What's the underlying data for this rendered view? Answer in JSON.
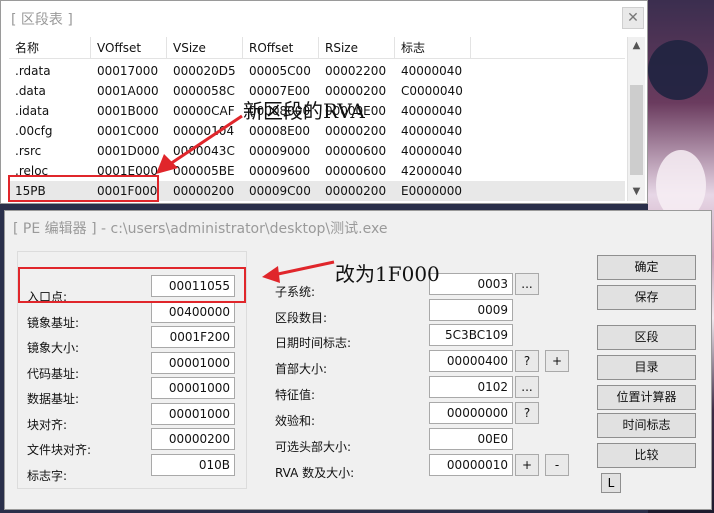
{
  "section_window": {
    "title": "[ 区段表 ]",
    "close_glyph": "✕",
    "columns": [
      "名称",
      "VOffset",
      "VSize",
      "ROffset",
      "RSize",
      "标志"
    ],
    "rows": [
      [
        ".rdata",
        "00017000",
        "000020D5",
        "00005C00",
        "00002200",
        "40000040"
      ],
      [
        ".data",
        "0001A000",
        "0000058C",
        "00007E00",
        "00000200",
        "C0000040"
      ],
      [
        ".idata",
        "0001B000",
        "00000CAF",
        "00008000",
        "00000E00",
        "40000040"
      ],
      [
        ".00cfg",
        "0001C000",
        "00000104",
        "00008E00",
        "00000200",
        "40000040"
      ],
      [
        ".rsrc",
        "0001D000",
        "0000043C",
        "00009000",
        "00000600",
        "40000040"
      ],
      [
        ".reloc",
        "0001E000",
        "000005BE",
        "00009600",
        "00000600",
        "42000040"
      ],
      [
        "15PB",
        "0001F000",
        "00000200",
        "00009C00",
        "00000200",
        "E0000000"
      ]
    ],
    "scroll_up": "▲",
    "scroll_down": "▼"
  },
  "annotations": {
    "new_section_rva": "新区段的RVA",
    "change_to": "改为1F000",
    "accent_color": "#e0262b"
  },
  "pe_window": {
    "title": "[ PE 编辑器 ] - c:\\users\\administrator\\desktop\\测试.exe",
    "left_fields": [
      {
        "label": "入口点:",
        "value": "00011055"
      },
      {
        "label": "镜象基址:",
        "value": "00400000"
      },
      {
        "label": "镜象大小:",
        "value": "0001F200"
      },
      {
        "label": "代码基址:",
        "value": "00001000"
      },
      {
        "label": "数据基址:",
        "value": "00001000"
      },
      {
        "label": "块对齐:",
        "value": "00001000"
      },
      {
        "label": "文件块对齐:",
        "value": "00000200"
      },
      {
        "label": "标志字:",
        "value": "010B"
      }
    ],
    "right_fields": [
      {
        "label": "子系统:",
        "value": "0003"
      },
      {
        "label": "区段数目:",
        "value": "0009"
      },
      {
        "label": "日期时间标志:",
        "value": "5C3BC109"
      },
      {
        "label": "首部大小:",
        "value": "00000400"
      },
      {
        "label": "特征值:",
        "value": "0102"
      },
      {
        "label": "效验和:",
        "value": "00000000"
      },
      {
        "label": "可选头部大小:",
        "value": "00E0"
      },
      {
        "label": "RVA 数及大小:",
        "value": "00000010"
      }
    ],
    "mini_buttons": {
      "ellipsis": "...",
      "question": "?",
      "plus": "+",
      "minus": "-"
    },
    "side_buttons": [
      "确定",
      "保存",
      "区段",
      "目录",
      "位置计算器",
      "时间标志",
      "比较"
    ],
    "l_button": "L"
  }
}
